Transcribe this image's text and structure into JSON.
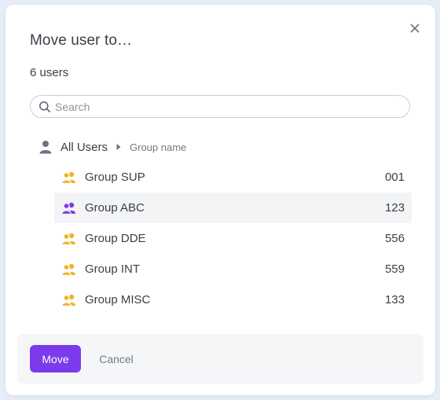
{
  "dialog": {
    "title": "Move user to…",
    "close_icon": "close-icon",
    "user_count": "6 users"
  },
  "search": {
    "placeholder": "Search",
    "value": "",
    "icon": "search-icon"
  },
  "breadcrumb": {
    "icon": "user-icon",
    "root": "All Users",
    "separator_icon": "caret-right-icon",
    "current": "Group name"
  },
  "groups": [
    {
      "name": "Group SUP",
      "number": "001",
      "icon": "users-icon",
      "icon_color": "#f0b429",
      "selected": false
    },
    {
      "name": "Group ABC",
      "number": "123",
      "icon": "users-icon",
      "icon_color": "#7c3aed",
      "selected": true
    },
    {
      "name": "Group DDE",
      "number": "556",
      "icon": "users-icon",
      "icon_color": "#f0b429",
      "selected": false
    },
    {
      "name": "Group INT",
      "number": "559",
      "icon": "users-icon",
      "icon_color": "#f0b429",
      "selected": false
    },
    {
      "name": "Group MISC",
      "number": "133",
      "icon": "users-icon",
      "icon_color": "#f0b429",
      "selected": false
    }
  ],
  "footer": {
    "move_label": "Move",
    "cancel_label": "Cancel"
  },
  "colors": {
    "accent": "#7c3aed",
    "group_icon": "#f0b429",
    "text": "#3a3f47",
    "muted": "#6f7a86"
  }
}
